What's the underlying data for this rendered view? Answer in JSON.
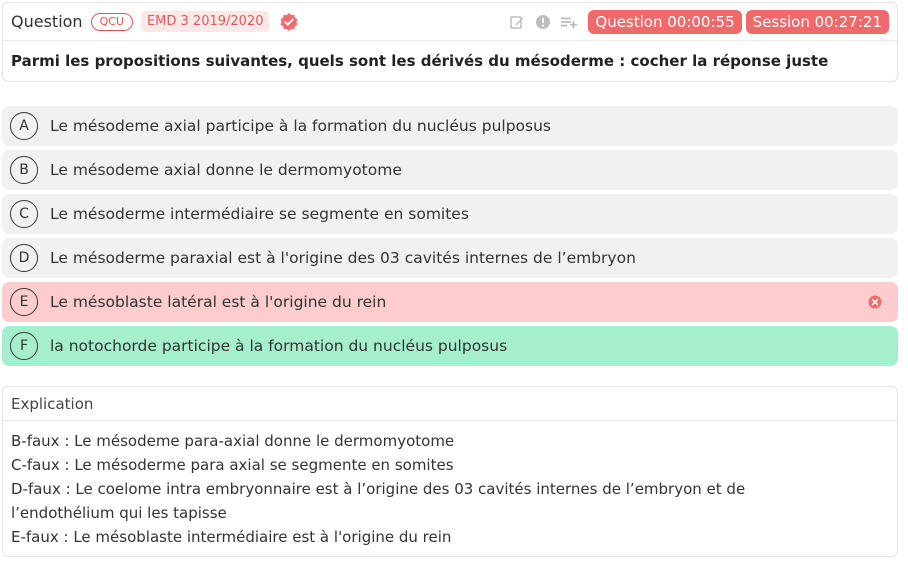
{
  "question": {
    "header_label": "Question",
    "type_badge": "QCU",
    "source_badge": "EMD 3 2019/2020",
    "timer_question": "Question 00:00:55",
    "timer_session": "Session 00:27:21",
    "text": "Parmi les propositions suivantes, quels sont les dérivés du mésoderme : cocher la réponse juste"
  },
  "options": [
    {
      "letter": "A",
      "text": "Le mésodeme axial participe à la formation du nucléus pulposus",
      "state": "neutral"
    },
    {
      "letter": "B",
      "text": "Le mésodeme axial donne le dermomyotome",
      "state": "neutral"
    },
    {
      "letter": "C",
      "text": "Le mésoderme intermédiaire se segmente en somites",
      "state": "neutral"
    },
    {
      "letter": "D",
      "text": "Le mésoderme paraxial est à l'origine des 03 cavités internes de l’embryon",
      "state": "neutral"
    },
    {
      "letter": "E",
      "text": "Le mésoblaste latéral est à l'origine du rein",
      "state": "wrong"
    },
    {
      "letter": "F",
      "text": "la notochorde participe à la formation du nucléus pulposus",
      "state": "correct"
    }
  ],
  "explanation": {
    "title": "Explication",
    "lines": [
      "B-faux : Le mésodeme para-axial donne le dermomyotome",
      "C-faux : Le mésoderme para axial se segmente en somites",
      "D-faux : Le coelome intra embryonnaire est à l’origine des 03 cavités internes de l’embryon et de",
      "l’endothélium qui les tapisse",
      "E-faux : Le mésoblaste intermédiaire est à l'origine du rein"
    ]
  },
  "colors": {
    "accent": "#ef6b6b",
    "wrong_bg": "#fdcccc",
    "correct_bg": "#a6efcd",
    "neutral_bg": "#f1f1f2"
  },
  "icons": [
    "verified-badge-icon",
    "edit-icon",
    "report-icon",
    "add-to-playlist-icon",
    "wrong-answer-icon"
  ]
}
